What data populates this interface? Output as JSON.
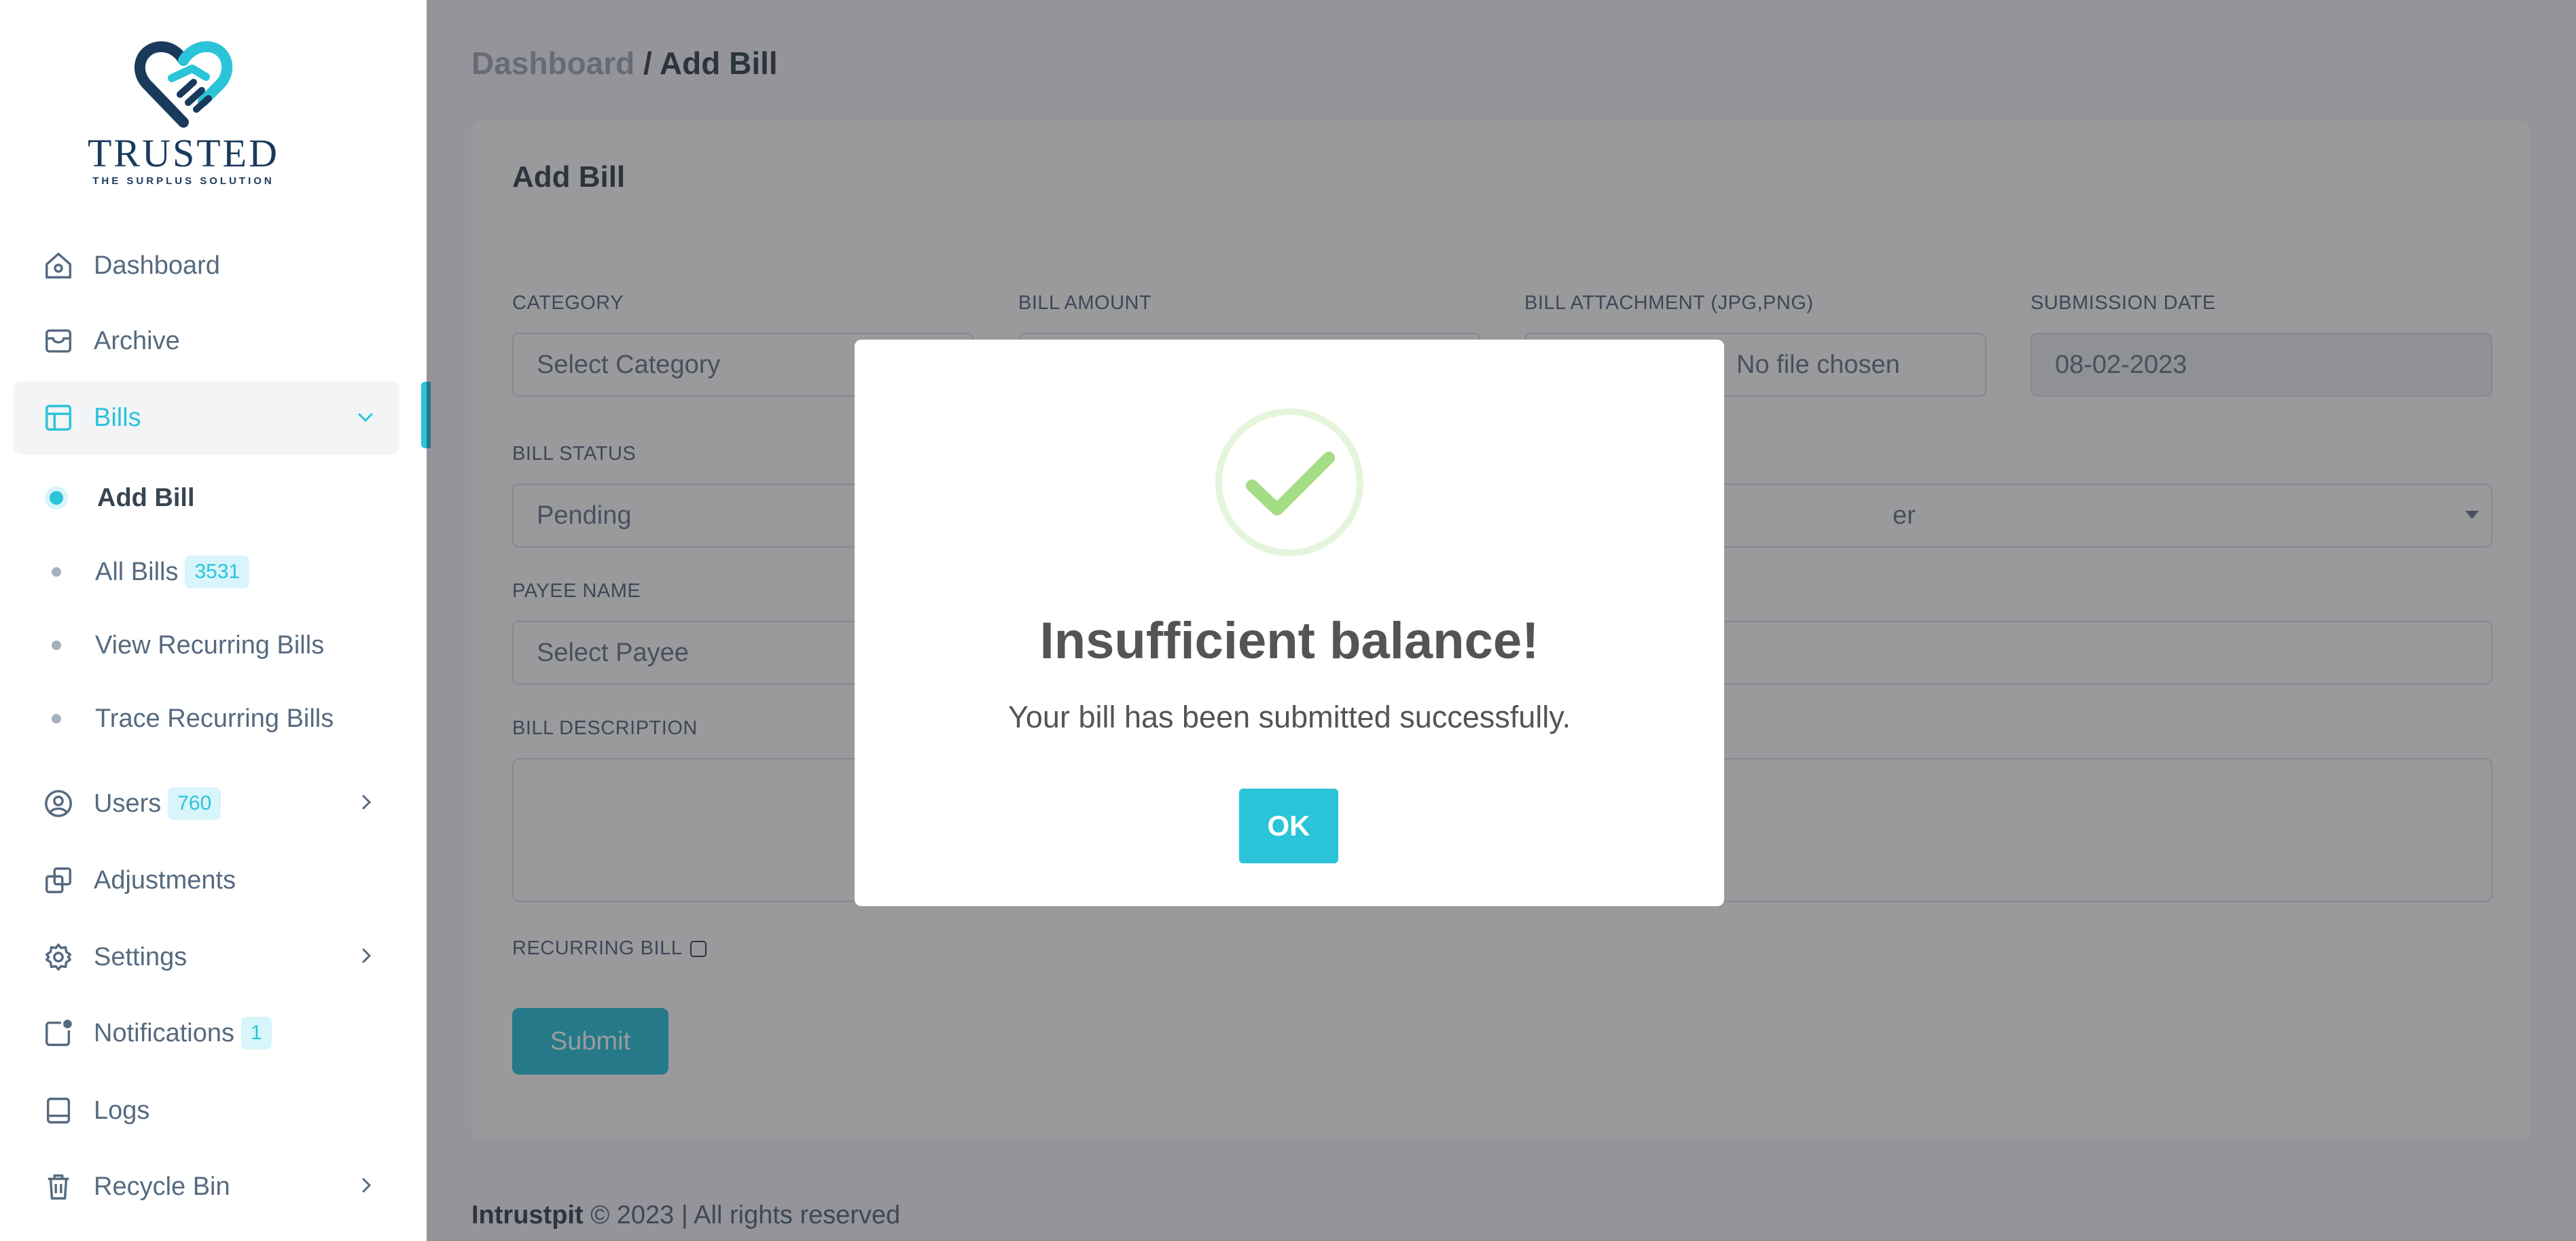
{
  "brand": {
    "name": "TRUSTED",
    "tagline": "THE SURPLUS SOLUTION",
    "accent": "#2bc4d9",
    "navy": "#1a3a5c"
  },
  "sidebar": {
    "items": [
      {
        "label": "Dashboard",
        "icon": "home-icon"
      },
      {
        "label": "Archive",
        "icon": "archive-icon"
      },
      {
        "label": "Bills",
        "icon": "layout-icon",
        "active": true
      },
      {
        "label": "Users",
        "icon": "user-circle-icon",
        "badge": "760"
      },
      {
        "label": "Adjustments",
        "icon": "copy-icon"
      },
      {
        "label": "Settings",
        "icon": "gear-icon"
      },
      {
        "label": "Notifications",
        "icon": "notification-icon",
        "badge": "1"
      },
      {
        "label": "Logs",
        "icon": "book-icon"
      },
      {
        "label": "Recycle Bin",
        "icon": "trash-icon"
      }
    ],
    "bills_sub": [
      {
        "label": "Add Bill",
        "active": true
      },
      {
        "label": "All Bills",
        "badge": "3531"
      },
      {
        "label": "View Recurring Bills"
      },
      {
        "label": "Trace Recurring Bills"
      }
    ]
  },
  "breadcrumb": {
    "parent": "Dashboard",
    "separator": " / ",
    "current": "Add Bill"
  },
  "form": {
    "title": "Add Bill",
    "category": {
      "label": "CATEGORY",
      "value": "Select Category"
    },
    "amount": {
      "label": "BILL AMOUNT",
      "value": ""
    },
    "attachment": {
      "label": "BILL ATTACHMENT (JPG,PNG)",
      "value": "No file chosen"
    },
    "submission_date": {
      "label": "SUBMISSION DATE",
      "value": "08-02-2023"
    },
    "status": {
      "label": "BILL STATUS",
      "value": "Pending"
    },
    "payment_select": {
      "value_partial": "er"
    },
    "payee": {
      "label": "PAYEE NAME",
      "value": "Select Payee"
    },
    "description": {
      "label": "BILL DESCRIPTION",
      "value": ""
    },
    "recurring": {
      "label": "RECURRING BILL"
    },
    "submit_label": "Submit"
  },
  "footer": {
    "brand": "Intrustpit",
    "text": " © 2023 | All rights reserved"
  },
  "modal": {
    "title": "Insufficient balance!",
    "text": "Your bill has been submitted successfully.",
    "ok_label": "OK",
    "icon": "success-check-icon",
    "check_color": "#a5dc86"
  }
}
